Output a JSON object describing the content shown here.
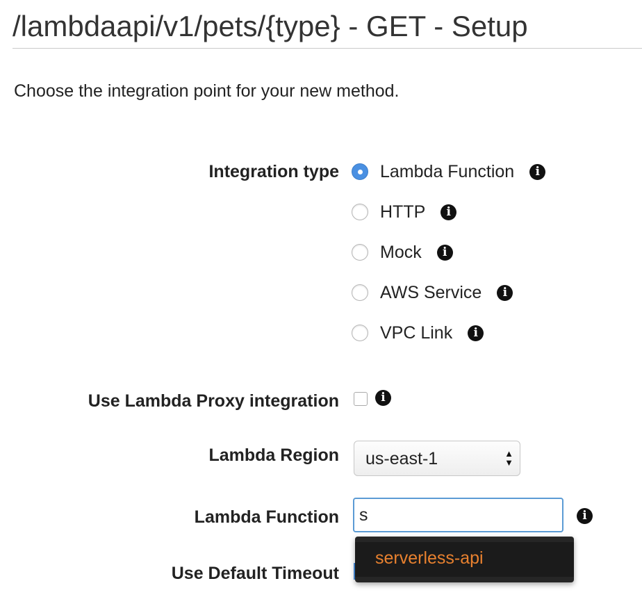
{
  "header": {
    "title": "/lambdaapi/v1/pets/{type} - GET - Setup"
  },
  "intro_text": "Choose the integration point for your new method.",
  "integration_type": {
    "label": "Integration type",
    "selected": "Lambda Function",
    "options": [
      {
        "label": "Lambda Function",
        "checked": true
      },
      {
        "label": "HTTP",
        "checked": false
      },
      {
        "label": "Mock",
        "checked": false
      },
      {
        "label": "AWS Service",
        "checked": false
      },
      {
        "label": "VPC Link",
        "checked": false
      }
    ]
  },
  "proxy_integration": {
    "label": "Use Lambda Proxy integration",
    "checked": false
  },
  "lambda_region": {
    "label": "Lambda Region",
    "value": "us-east-1"
  },
  "lambda_function": {
    "label": "Lambda Function",
    "value": "s",
    "suggestions": [
      "serverless-api"
    ]
  },
  "default_timeout": {
    "label": "Use Default Timeout",
    "checked": true
  },
  "icons": {
    "info": "info-icon",
    "select_arrows": "up-down-arrows-icon"
  },
  "colors": {
    "radio_selected": "#4a90e2",
    "input_focus_border": "#5b9bd5",
    "suggestion_background": "#1b1b1b",
    "suggestion_text": "#e8812f"
  }
}
